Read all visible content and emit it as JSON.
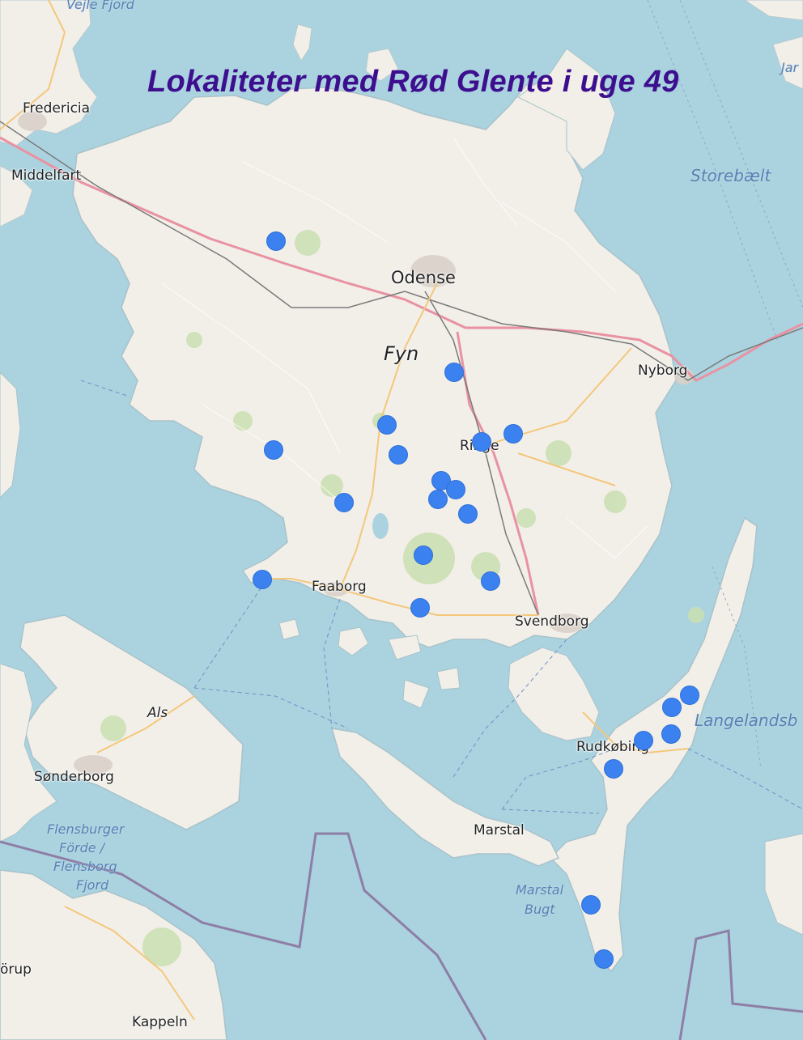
{
  "title": "Lokaliteter med Rød Glente i uge 49",
  "places": {
    "fredericia": "Fredericia",
    "middelfart": "Middelfart",
    "odense": "Odense",
    "fyn": "Fyn",
    "nyborg": "Nyborg",
    "ringe": "Ringe",
    "faaborg": "Faaborg",
    "svendborg": "Svendborg",
    "rudkobing": "Rudkøbing",
    "marstal": "Marstal",
    "als": "Als",
    "sonderborg": "Sønderborg",
    "kappeln": "Kappeln",
    "borup": "örup",
    "jar": "Jar"
  },
  "water": {
    "vejle": "Vejle Fjord",
    "storebaelt": "Storebælt",
    "langelandsbaelt": "Langelandsb",
    "flensburger_1": "Flensburger",
    "flensburger_2": "Förde /",
    "flensburger_3": "Flensborg",
    "flensburger_4": "Fjord",
    "marstal_bugt_1": "Marstal",
    "marstal_bugt_2": "Bugt"
  },
  "marker_color": "#3b82f0",
  "marker_count": 24
}
